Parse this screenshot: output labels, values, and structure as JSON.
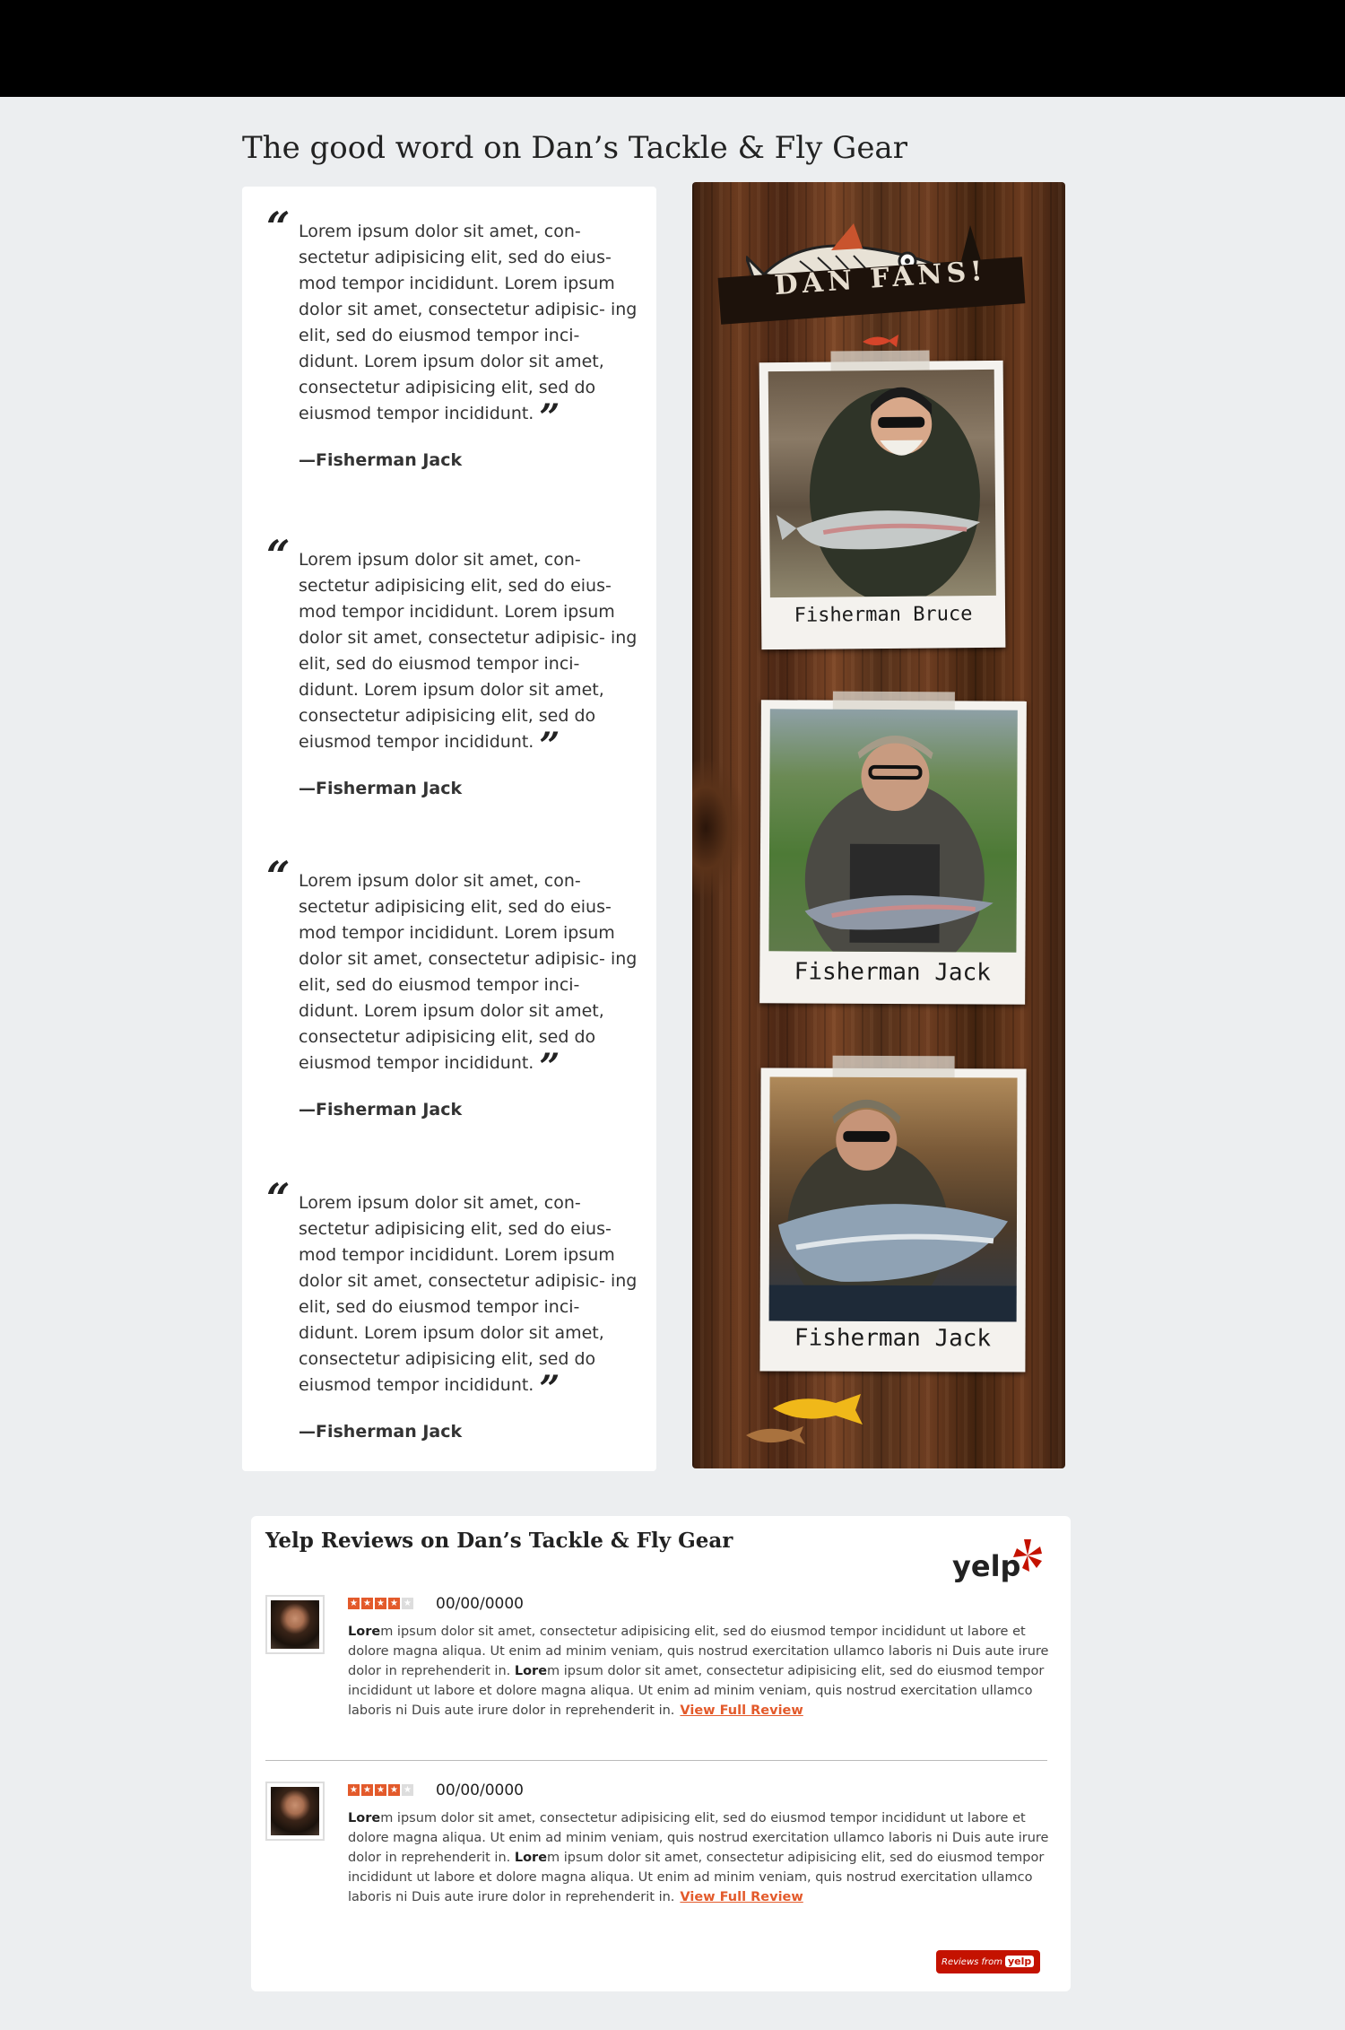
{
  "page": {
    "title": "The good word on Dan’s Tackle & Fly Gear"
  },
  "testimonials": [
    {
      "text": "Lorem ipsum dolor sit amet, con- sectetur adipisicing elit, sed do eius- mod tempor incididunt. Lorem ipsum dolor sit amet, consectetur adipisic- ing elit, sed do eiusmod tempor inci- didunt. Lorem ipsum dolor sit amet, consectetur adipisicing elit, sed do eiusmod tempor incididunt.",
      "author": "—Fisherman Jack"
    },
    {
      "text": "Lorem ipsum dolor sit amet, con- sectetur adipisicing elit, sed do eius- mod tempor incididunt. Lorem ipsum dolor sit amet, consectetur adipisic- ing elit, sed do eiusmod tempor inci- didunt. Lorem ipsum dolor sit amet, consectetur adipisicing elit, sed do eiusmod tempor incididunt.",
      "author": "—Fisherman Jack"
    },
    {
      "text": "Lorem ipsum dolor sit amet, con- sectetur adipisicing elit, sed do eius- mod tempor incididunt. Lorem ipsum dolor sit amet, consectetur adipisic- ing elit, sed do eiusmod tempor inci- didunt. Lorem ipsum dolor sit amet, consectetur adipisicing elit, sed do eiusmod tempor incididunt.",
      "author": "—Fisherman Jack"
    },
    {
      "text": "Lorem ipsum dolor sit amet, con- sectetur adipisicing elit, sed do eius- mod tempor incididunt. Lorem ipsum dolor sit amet, consectetur adipisic- ing elit, sed do eiusmod tempor inci- didunt. Lorem ipsum dolor sit amet, consectetur adipisicing elit, sed do eiusmod tempor incididunt.",
      "author": "—Fisherman Jack"
    }
  ],
  "fans": {
    "logo_text": "DAN FANS!",
    "photos": [
      {
        "caption": "Fisherman Bruce"
      },
      {
        "caption": "Fisherman Jack"
      },
      {
        "caption": "Fisherman Jack"
      }
    ]
  },
  "yelp": {
    "title": "Yelp Reviews on Dan’s Tackle & Fly Gear",
    "logo_text": "yelp",
    "rating": 4,
    "rating_max": 5,
    "reviews": [
      {
        "date": "00/00/0000",
        "text_bold": "Lore",
        "text_1": "m ipsum dolor sit amet, consectetur adipisicing elit, sed do eiusmod tempor incididunt ut labore et dolore magna aliqua. Ut enim ad minim veniam, quis nostrud exercitation ullamco laboris ni Duis aute irure dolor in reprehenderit in. ",
        "text_bold_2": "Lore",
        "text_2": "m ipsum dolor sit amet, consectetur adipisicing elit, sed do eiusmod tempor incididunt ut labore et dolore magna aliqua. Ut enim ad minim veniam, quis nostrud exercitation ullamco laboris ni Duis aute irure dolor in reprehenderit in.",
        "link": "View Full Review"
      },
      {
        "date": "00/00/0000",
        "text_bold": "Lore",
        "text_1": "m ipsum dolor sit amet, consectetur adipisicing elit, sed do eiusmod tempor incididunt ut labore et dolore magna aliqua. Ut enim ad minim veniam, quis nostrud exercitation ullamco laboris ni Duis aute irure dolor in reprehenderit in. ",
        "text_bold_2": "Lore",
        "text_2": "m ipsum dolor sit amet, consectetur adipisicing elit, sed do eiusmod tempor incididunt ut labore et dolore magna aliqua. Ut enim ad minim veniam, quis nostrud exercitation ullamco laboris ni Duis aute irure dolor in reprehenderit in.",
        "link": "View Full Review"
      }
    ],
    "reviews_from_label": "Reviews from",
    "reviews_from_brand": "yelp"
  },
  "colors": {
    "accent": "#e35a2b",
    "yelp_red": "#c41200",
    "page_bg": "#eceef0"
  }
}
